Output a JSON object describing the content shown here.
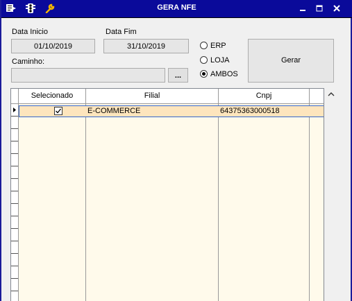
{
  "window": {
    "title": "GERA NFE"
  },
  "form": {
    "data_inicio_label": "Data Inicio",
    "data_inicio_value": "01/10/2019",
    "data_fim_label": "Data Fim",
    "data_fim_value": "31/10/2019",
    "caminho_label": "Caminho:",
    "caminho_value": "",
    "browse_label": "...",
    "gerar_label": "Gerar"
  },
  "options": [
    {
      "label": "ERP",
      "selected": false
    },
    {
      "label": "LOJA",
      "selected": false
    },
    {
      "label": "AMBOS",
      "selected": true
    }
  ],
  "grid": {
    "columns": [
      "Selecionado",
      "Filial",
      "Cnpj"
    ],
    "rows": [
      {
        "selecionado": true,
        "filial": "E-COMMERCE",
        "cnpj": "64375363000518"
      }
    ]
  },
  "icons": {
    "title_left": [
      "menu-icon",
      "traffic-light-icon",
      "wrench-icon"
    ],
    "window_controls": [
      "minimize-icon",
      "maximize-icon",
      "close-icon"
    ],
    "scroll": "scroll-up-icon"
  }
}
